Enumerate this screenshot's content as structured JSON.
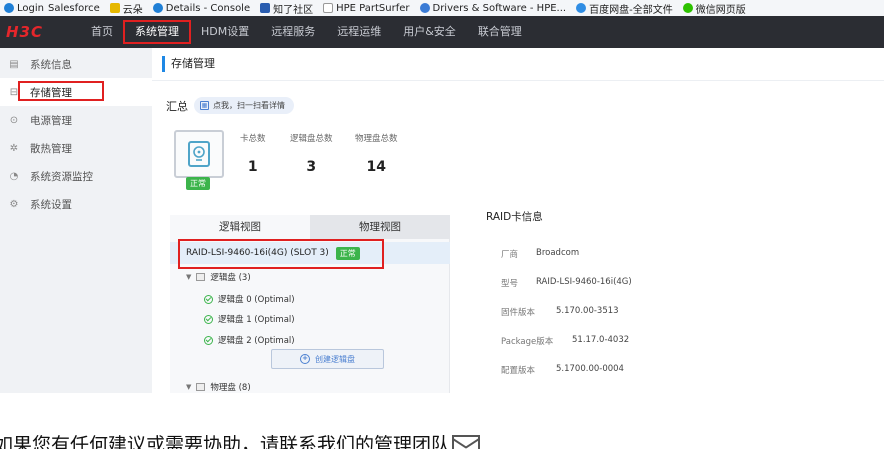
{
  "bookmarks": [
    {
      "label": "Login",
      "icon": "cloud-icon",
      "color": "#1f7fd6"
    },
    {
      "label": "Salesforce",
      "icon": "",
      "color": ""
    },
    {
      "label": "云朵",
      "icon": "folder-icon",
      "color": "#e6b800"
    },
    {
      "label": "Details - Console",
      "icon": "cloud-icon",
      "color": "#1f7fd6"
    },
    {
      "label": "知了社区",
      "icon": "bookmark-icon",
      "color": "#2a5db0"
    },
    {
      "label": "HPE PartSurfer",
      "icon": "page-icon",
      "color": "#999999"
    },
    {
      "label": "Drivers & Software - HPE...",
      "icon": "globe-icon",
      "color": "#3a7bd5"
    },
    {
      "label": "百度网盘-全部文件",
      "icon": "baidu-icon",
      "color": "#2f8de4"
    },
    {
      "label": "微信网页版",
      "icon": "wechat-icon",
      "color": "#2dc100"
    }
  ],
  "brand": {
    "logo": "H3C",
    "logo_color": "#e5262b"
  },
  "topnav": {
    "items": [
      "首页",
      "系统管理",
      "HDM设置",
      "远程服务",
      "远程运维",
      "用户&安全",
      "联合管理"
    ],
    "active": "系统管理"
  },
  "sidebar": {
    "items": [
      {
        "label": "系统信息",
        "icon": "info-icon"
      },
      {
        "label": "存储管理",
        "icon": "storage-icon",
        "active": true
      },
      {
        "label": "电源管理",
        "icon": "power-icon"
      },
      {
        "label": "散热管理",
        "icon": "fan-icon"
      },
      {
        "label": "系统资源监控",
        "icon": "monitor-icon"
      },
      {
        "label": "系统设置",
        "icon": "settings-icon"
      }
    ]
  },
  "page": {
    "title": "存储管理"
  },
  "summary": {
    "label": "汇总",
    "hint": "点我，扫一扫看详情",
    "status": "正常",
    "stats": [
      {
        "label": "卡总数",
        "value": "1"
      },
      {
        "label": "逻辑盘总数",
        "value": "3"
      },
      {
        "label": "物理盘总数",
        "value": "14"
      }
    ]
  },
  "tabs": [
    "逻辑视图",
    "物理视图"
  ],
  "tree": {
    "controller": "RAID-LSI-9460-16i(4G) (SLOT 3)",
    "controller_status": "正常",
    "logical_group": "逻辑盘 (3)",
    "logical_disks": [
      "逻辑盘 0 (Optimal)",
      "逻辑盘 1 (Optimal)",
      "逻辑盘 2 (Optimal)"
    ],
    "create_button": "创建逻辑盘",
    "physical_group": "物理盘 (8)"
  },
  "raid_info": {
    "title": "RAID卡信息",
    "rows": [
      {
        "key": "厂商",
        "value": "Broadcom"
      },
      {
        "key": "型号",
        "value": "RAID-LSI-9460-16i(4G)"
      },
      {
        "key": "固件版本",
        "value": "5.170.00-3513"
      },
      {
        "key": "Package版本",
        "value": "51.17.0-4032"
      },
      {
        "key": "配置版本",
        "value": "5.1700.00-0004"
      }
    ]
  },
  "footer": {
    "contact": "如果您有任何建议或需要协助，请联系我们的管理团队"
  },
  "colors": {
    "accent": "#1e88e5",
    "highlight_box": "#e02020",
    "ok_green": "#3cb44b",
    "nav_bg": "#2b2d33"
  }
}
